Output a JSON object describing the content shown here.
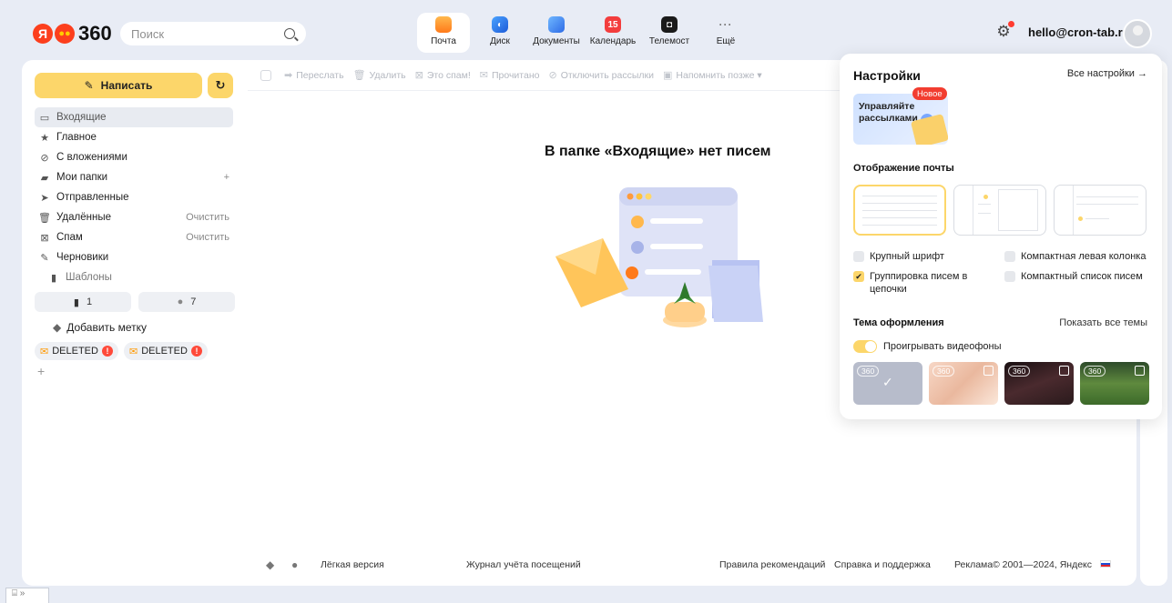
{
  "header": {
    "logo_ya": "Я",
    "logo_360": "360",
    "search_placeholder": "Поиск",
    "apps": [
      {
        "label": "Почта",
        "icon": "mail-icon",
        "active": true
      },
      {
        "label": "Диск",
        "icon": "disk-icon"
      },
      {
        "label": "Документы",
        "icon": "docs-icon"
      },
      {
        "label": "Календарь",
        "icon": "calendar-icon",
        "badge": "15"
      },
      {
        "label": "Телемост",
        "icon": "telemost-icon"
      },
      {
        "label": "Ещё",
        "icon": "more-icon"
      }
    ],
    "user_email": "hello@cron-tab.ru"
  },
  "sidebar": {
    "compose_label": "Написать",
    "folders": [
      {
        "label": "Входящие",
        "icon": "inbox-icon",
        "active": true
      },
      {
        "label": "Главное",
        "icon": "star-icon"
      },
      {
        "label": "С вложениями",
        "icon": "paperclip-icon"
      },
      {
        "label": "Мои папки",
        "icon": "folder-icon",
        "action": "+"
      },
      {
        "label": "Отправленные",
        "icon": "send-icon"
      },
      {
        "label": "Удалённые",
        "icon": "trash-icon",
        "action": "Очистить"
      },
      {
        "label": "Спам",
        "icon": "spam-icon",
        "action": "Очистить"
      },
      {
        "label": "Черновики",
        "icon": "drafts-icon"
      },
      {
        "label": "Шаблоны",
        "icon": "template-icon",
        "sub": true
      }
    ],
    "counters": [
      {
        "icon": "bookmark-icon",
        "value": "1"
      },
      {
        "icon": "dot-icon",
        "value": "7"
      }
    ],
    "add_label": "Добавить метку",
    "labels": [
      {
        "text": "DELETED"
      },
      {
        "text": "DELETED"
      }
    ],
    "plus": "+"
  },
  "toolbar": {
    "items": [
      {
        "label": "Переслать",
        "icon": "forward-icon"
      },
      {
        "label": "Удалить",
        "icon": "trash-icon"
      },
      {
        "label": "Это спам!",
        "icon": "spam-icon"
      },
      {
        "label": "Прочитано",
        "icon": "read-icon"
      },
      {
        "label": "Отключить рассылки",
        "icon": "unsubscribe-icon"
      },
      {
        "label": "Напомнить позже ▾",
        "icon": "remind-icon"
      }
    ]
  },
  "main": {
    "empty_title": "В папке «Входящие» нет писем"
  },
  "footer": {
    "light_version": "Лёгкая версия",
    "visit_log": "Журнал учёта посещений",
    "rules": "Правила рекомендаций",
    "support": "Справка и поддержка",
    "ads": "Реклама",
    "copyright": "© 2001—2024, Яндекс"
  },
  "settings": {
    "title": "Настройки",
    "all_settings": "Все настройки →",
    "promo_text": "Управляйте рассылками",
    "badge_new": "Новое",
    "display_title": "Отображение почты",
    "options": {
      "large_font": "Крупный шрифт",
      "compact_left": "Компактная левая колонка",
      "threading": "Группировка писем в цепочки",
      "compact_list": "Компактный список писем"
    },
    "theme_title": "Тема оформления",
    "show_all_themes": "Показать все темы",
    "video_bg": "Проигрывать видеофоны",
    "theme_badge": "360"
  },
  "statusbar": {
    "text": "⌸ »"
  }
}
